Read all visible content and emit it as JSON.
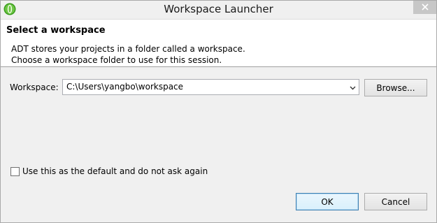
{
  "window": {
    "title": "Workspace Launcher"
  },
  "header": {
    "title": "Select a workspace",
    "description_line1": "ADT stores your projects in a folder called a workspace.",
    "description_line2": "Choose a workspace folder to use for this session."
  },
  "workspace": {
    "label": "Workspace:",
    "value": "C:\\Users\\yangbo\\workspace",
    "browse_label": "Browse..."
  },
  "options": {
    "default_checkbox_label": "Use this as the default and do not ask again",
    "default_checked": false
  },
  "footer": {
    "ok_label": "OK",
    "cancel_label": "Cancel"
  },
  "icons": {
    "app": "eclipse-app-icon",
    "close": "close-icon",
    "dropdown": "chevron-down-icon"
  }
}
